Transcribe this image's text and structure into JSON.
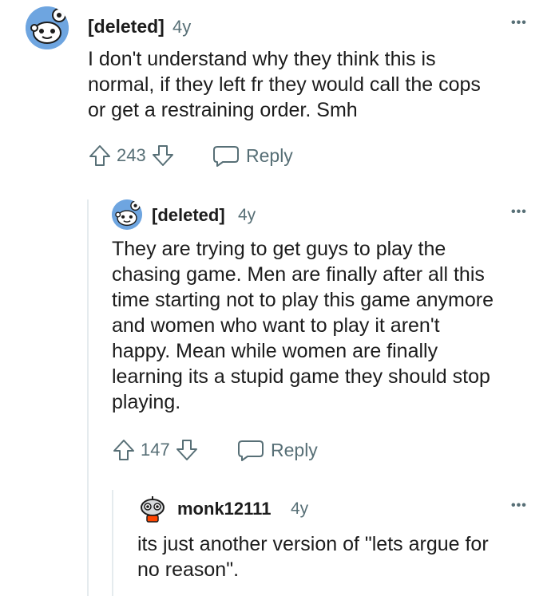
{
  "comments": [
    {
      "author": "[deleted]",
      "age": "4y",
      "body": [
        "I don't understand why they think this is",
        "normal, if they left fr they would call the cops",
        "or get a restraining order. Smh"
      ],
      "score": "243",
      "reply_label": "Reply",
      "more_label": "•••",
      "avatar_icon": "snoo-avatar-icon"
    },
    {
      "author": "[deleted]",
      "age": "4y",
      "body": [
        "They are trying to get guys to play the",
        "chasing game. Men are finally after all this",
        "time starting not to play this game anymore",
        "and women who want to play it aren't",
        "happy. Mean while women are finally",
        "learning its a stupid game they should stop",
        "playing."
      ],
      "score": "147",
      "reply_label": "Reply",
      "more_label": "•••",
      "avatar_icon": "snoo-avatar-icon"
    },
    {
      "author": "monk12111",
      "age": "4y",
      "body": [
        "its just another version of \"lets argue for",
        "no reason\"."
      ],
      "more_label": "•••",
      "avatar_icon": "robot-snoo-avatar-icon"
    }
  ],
  "colors": {
    "text": "#1c1c1c",
    "meta": "#576f76",
    "avatar_blue": "#6ea5e0",
    "thread_line": "#e5ebee"
  }
}
